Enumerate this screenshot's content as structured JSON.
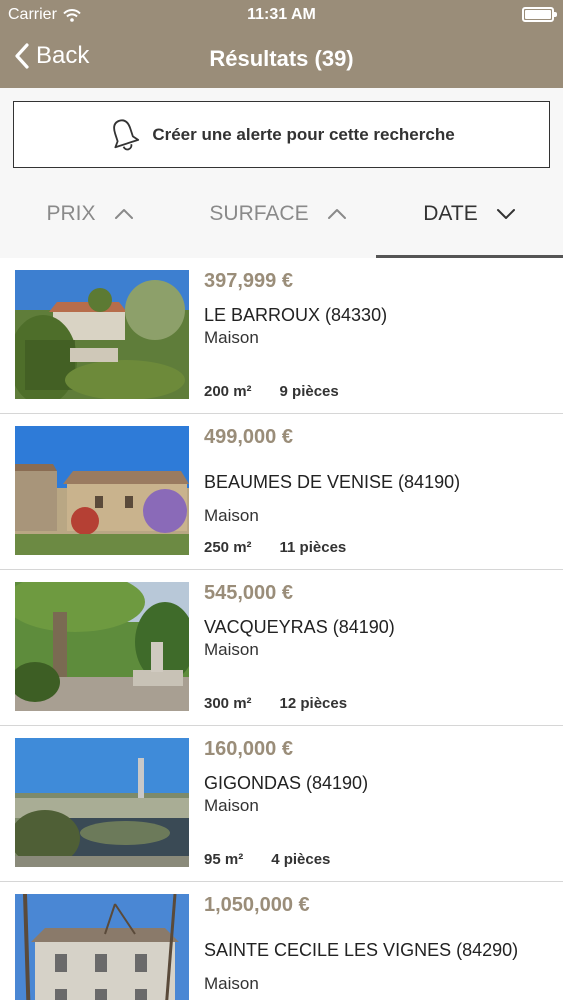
{
  "status_bar": {
    "carrier": "Carrier",
    "time": "11:31 AM"
  },
  "nav": {
    "back_label": "Back",
    "title": "Résultats (39)"
  },
  "alert": {
    "label": "Créer une alerte pour cette recherche"
  },
  "sort_tabs": [
    {
      "label": "PRIX",
      "direction": "up",
      "active": false
    },
    {
      "label": "SURFACE",
      "direction": "up",
      "active": false
    },
    {
      "label": "DATE",
      "direction": "down",
      "active": true
    }
  ],
  "listings": [
    {
      "price": "397,999 €",
      "city": "LE BARROUX (84330)",
      "type": "Maison",
      "surface": "200 m²",
      "rooms": "9 pièces"
    },
    {
      "price": "499,000 €",
      "city": "BEAUMES DE VENISE (84190)",
      "type": "Maison",
      "surface": "250 m²",
      "rooms": "11 pièces"
    },
    {
      "price": "545,000 €",
      "city": "VACQUEYRAS (84190)",
      "type": "Maison",
      "surface": "300 m²",
      "rooms": "12 pièces"
    },
    {
      "price": "160,000 €",
      "city": "GIGONDAS (84190)",
      "type": "Maison",
      "surface": "95 m²",
      "rooms": "4 pièces"
    },
    {
      "price": "1,050,000 €",
      "city": "SAINTE CECILE LES VIGNES (84290)",
      "type": "Maison",
      "surface": "",
      "rooms": ""
    }
  ],
  "colors": {
    "header": "#9a8d79",
    "price": "#9a8d79",
    "background": "#f7f7f7"
  }
}
